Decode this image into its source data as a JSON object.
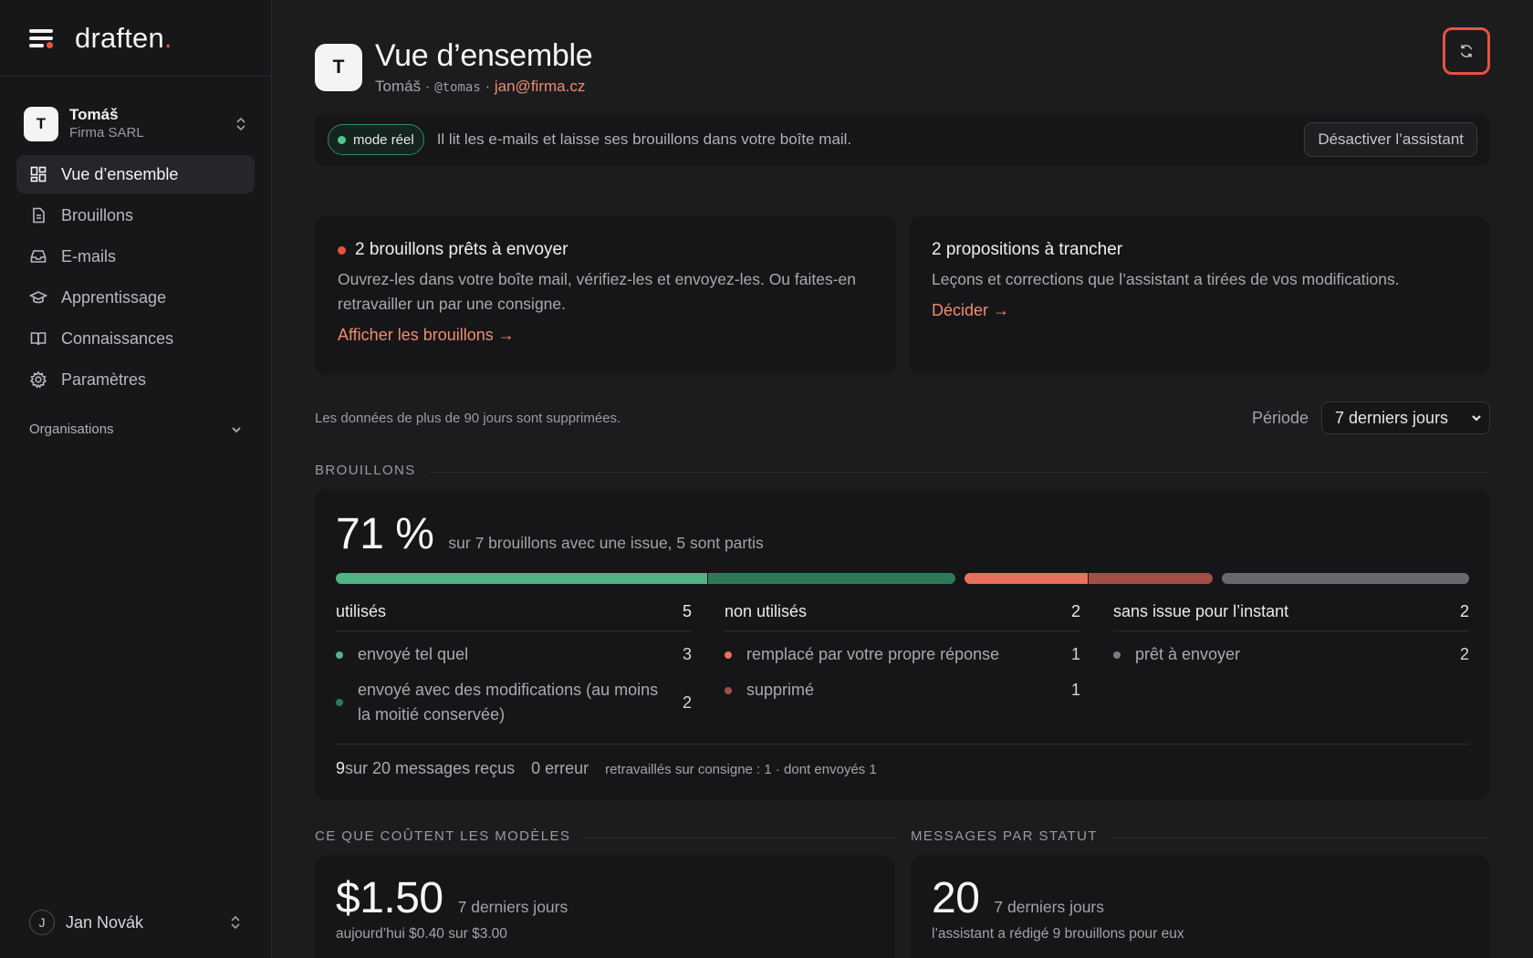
{
  "brand": {
    "logo_text": "draften",
    "logo_dot": "."
  },
  "org": {
    "avatar": "T",
    "name": "Tomáš",
    "company": "Firma SARL"
  },
  "nav": [
    {
      "label": "Vue d’ensemble",
      "icon": "grid-icon",
      "active": true
    },
    {
      "label": "Brouillons",
      "icon": "document-icon"
    },
    {
      "label": "E-mails",
      "icon": "inbox-icon"
    },
    {
      "label": "Apprentissage",
      "icon": "graduation-cap-icon"
    },
    {
      "label": "Connaissances",
      "icon": "book-icon"
    },
    {
      "label": "Paramètres",
      "icon": "gear-icon"
    }
  ],
  "organisations_label": "Organisations",
  "user": {
    "avatar": "J",
    "name": "Jan Novák"
  },
  "header": {
    "avatar": "T",
    "title": "Vue d’ensemble",
    "name": "Tomáš",
    "handle": "@tomas",
    "email": "jan@firma.cz",
    "sep": " · "
  },
  "mode": {
    "label": "mode réel",
    "text": "Il lit les e-mails et laisse ses brouillons dans votre boîte mail.",
    "button": "Désactiver l’assistant"
  },
  "cards": {
    "drafts_ready": {
      "title": "2 brouillons prêts à envoyer",
      "body": "Ouvrez-les dans votre boîte mail, vérifiez-les et envoyez-les. Ou faites-en retravailler un par une consigne.",
      "link": "Afficher les brouillons →"
    },
    "proposals": {
      "title": "2 propositions à trancher",
      "body": "Leçons et corrections que l’assistant a tirées de vos modifications.",
      "link": "Décider →"
    }
  },
  "retention": "Les données de plus de 90 jours sont supprimées.",
  "period": {
    "label": "Période",
    "value": "7 derniers jours"
  },
  "sections": {
    "drafts": "BROUILLONS",
    "costs": "CE QUE COÛTENT LES MODÈLES",
    "status": "MESSAGES PAR STATUT"
  },
  "drafts": {
    "percent": "71 %",
    "summary": "sur 7 brouillons avec une issue, 5 sont partis",
    "segments": [
      {
        "value": 3,
        "color": "#4fb584"
      },
      {
        "value": 2,
        "color": "#2f7a56"
      },
      {
        "value": 1,
        "color": "#e8705c"
      },
      {
        "value": 1,
        "color": "#a34e47"
      },
      {
        "value": 2,
        "color": "#68686e"
      }
    ],
    "columns": [
      {
        "title": "utilisés",
        "count": "5",
        "rows": [
          {
            "label": "envoyé tel quel",
            "count": "3",
            "color": "#4fb584"
          },
          {
            "label": "envoyé avec des modifications (au moins la moitié conservée)",
            "count": "2",
            "color": "#2f7a56"
          }
        ]
      },
      {
        "title": "non utilisés",
        "count": "2",
        "rows": [
          {
            "label": "remplacé par votre propre réponse",
            "count": "1",
            "color": "#e8705c"
          },
          {
            "label": "supprimé",
            "count": "1",
            "color": "#a34e47"
          }
        ]
      },
      {
        "title": "sans issue pour l’instant",
        "count": "2",
        "rows": [
          {
            "label": "prêt à envoyer",
            "count": "2",
            "color": "#7a7a80"
          }
        ]
      }
    ],
    "footer": {
      "received_num": "9",
      "received_text": " sur 20 messages reçus",
      "errors": "0 erreur",
      "reworked": "retravaillés sur consigne : 1 · dont envoyés 1"
    }
  },
  "costs": {
    "value": "$1.50",
    "period": "7 derniers jours",
    "note": "aujourd’hui $0.40 sur $3.00"
  },
  "status": {
    "value": "20",
    "period": "7 derniers jours",
    "note": "l’assistant a rédigé 9 brouillons pour eux"
  },
  "colors": {
    "accent": "#e8533f",
    "link": "#f08c6e",
    "success": "#4fb584"
  }
}
